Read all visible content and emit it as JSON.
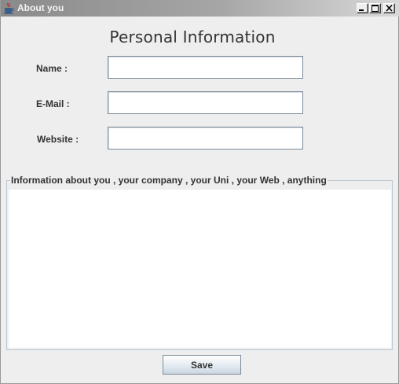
{
  "window": {
    "title": "About you",
    "controls": {
      "minimize": "minimize-icon",
      "maximize": "maximize-icon",
      "close": "close-icon"
    }
  },
  "form": {
    "heading": "Personal Information",
    "fields": [
      {
        "label": "Name :",
        "value": ""
      },
      {
        "label": "E-Mail :",
        "value": ""
      },
      {
        "label": "Website :",
        "value": ""
      }
    ],
    "about_group": {
      "legend": "Information about you  , your company , your Uni , your Web , anything",
      "value": ""
    },
    "save_label": "Save"
  },
  "colors": {
    "titlebar_start": "#8a8a8a",
    "titlebar_end": "#d9d9d9",
    "background": "#eeeeee",
    "input_border": "#7a8a99"
  }
}
